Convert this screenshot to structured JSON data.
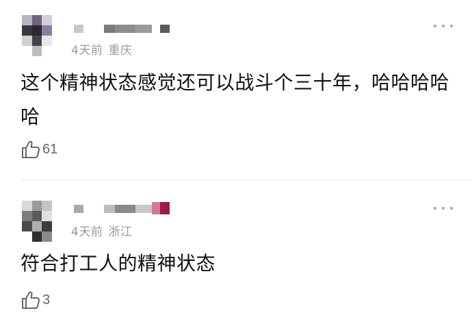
{
  "comments": [
    {
      "time": "4天前",
      "location": "重庆",
      "text": "这个精神状态感觉还可以战斗个三十年，哈哈哈哈哈",
      "likes": "61",
      "avatar_colors": [
        "#b8b6bc",
        "#6e6478",
        "#d2d0d6",
        "#ffffff",
        "#3a3540",
        "#2b2830",
        "#8b7ea0",
        "#ffffff",
        "#cfcfcf",
        "#45424a",
        "#e8e8ea",
        "#ffffff",
        "#ffffff",
        "#bdbdbd",
        "#ffffff",
        "#ffffff"
      ],
      "username_colors": [
        "#c9c9c9",
        "#ffffff",
        "#7a7a7a",
        "#8c8c8c",
        "#9a9a9a",
        "#ffffff",
        "#5a5a5a"
      ]
    },
    {
      "time": "4天前",
      "location": "浙江",
      "text": "符合打工人的精神状态",
      "likes": "3",
      "avatar_colors": [
        "#d8d8d8",
        "#9a9a9a",
        "#c4c4c4",
        "#ffffff",
        "#7c7c78",
        "#5a5a56",
        "#e0e0e0",
        "#ffffff",
        "#4a4a48",
        "#b0b0ac",
        "#3c3c3a",
        "#ffffff",
        "#ffffff",
        "#2e2e2c",
        "#8a8a88",
        "#ffffff"
      ],
      "username_colors": [
        "#a8a8a8",
        "#ffffff",
        "#bcbcbc",
        "#8a8a8a",
        "#c8c8c8",
        "#d07a94",
        "#a01848"
      ]
    }
  ]
}
